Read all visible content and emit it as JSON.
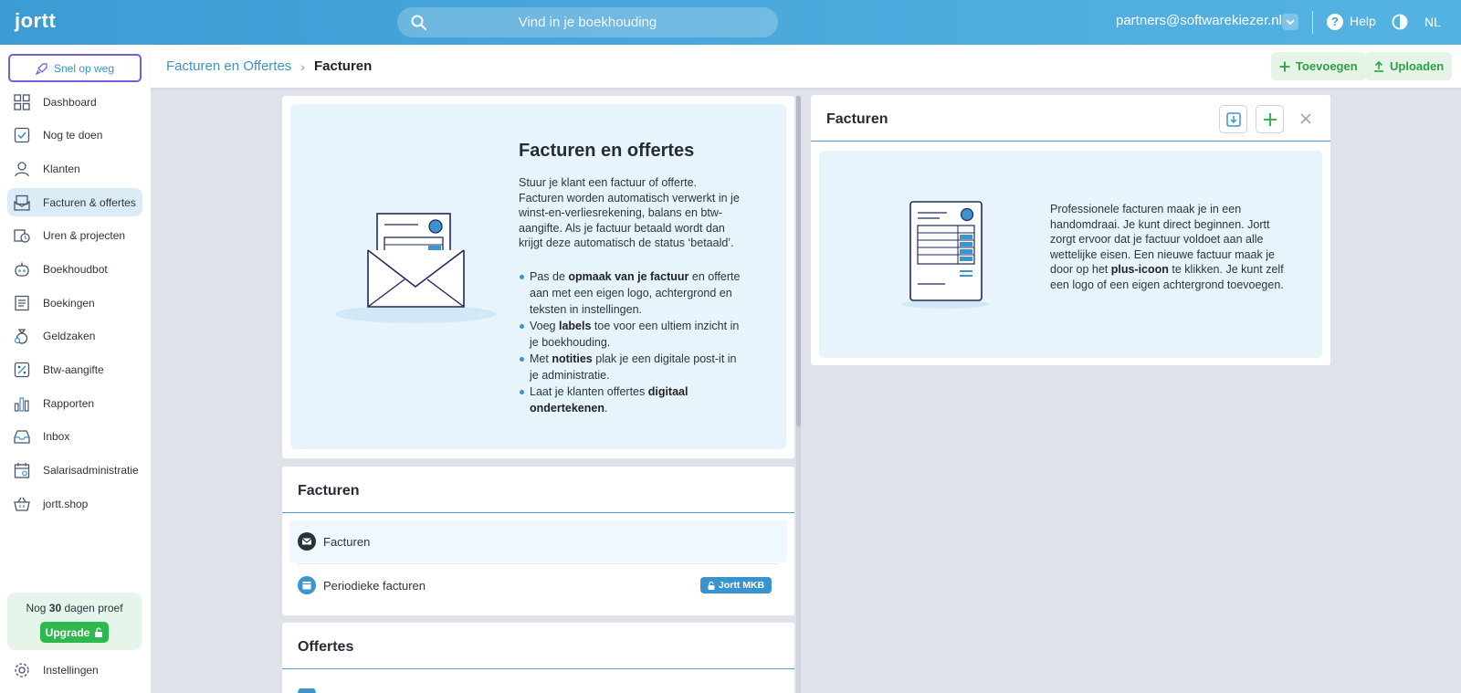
{
  "topbar": {
    "logo": "jortt",
    "search_placeholder": "Vind in je boekhouding",
    "account": "partners@softwarekiezer.nl",
    "help": "Help",
    "language": "NL"
  },
  "sidebar": {
    "quickstart": "Snel op weg",
    "items": [
      {
        "label": "Dashboard",
        "icon": "dashboard-icon"
      },
      {
        "label": "Nog te doen",
        "icon": "checkbox-icon"
      },
      {
        "label": "Klanten",
        "icon": "user-icon"
      },
      {
        "label": "Facturen & offertes",
        "icon": "invoice-icon",
        "active": true
      },
      {
        "label": "Uren & projecten",
        "icon": "clock-icon"
      },
      {
        "label": "Boekhoudbot",
        "icon": "bot-icon"
      },
      {
        "label": "Boekingen",
        "icon": "book-icon"
      },
      {
        "label": "Geldzaken",
        "icon": "money-bag-icon"
      },
      {
        "label": "Btw-aangifte",
        "icon": "percent-icon"
      },
      {
        "label": "Rapporten",
        "icon": "bar-chart-icon"
      },
      {
        "label": "Inbox",
        "icon": "inbox-icon"
      },
      {
        "label": "Salarisadministratie",
        "icon": "calendar-icon"
      },
      {
        "label": "jortt.shop",
        "icon": "basket-icon"
      }
    ],
    "trial": {
      "prefix": "Nog ",
      "days": "30",
      "suffix": " dagen proef",
      "upgrade": "Upgrade"
    },
    "settings": "Instellingen"
  },
  "subheader": {
    "breadcrumb_parent": "Facturen en Offertes",
    "breadcrumb_current": "Facturen",
    "add_label": "Toevoegen",
    "upload_label": "Uploaden"
  },
  "intro": {
    "title": "Facturen en offertes",
    "description": "Stuur je klant een factuur of offerte. Facturen worden automatisch verwerkt in je winst-en-verliesrekening, balans en btw-aangifte. Als je factuur betaald wordt dan krijgt deze automatisch de status ‘betaald’.",
    "bullets": [
      {
        "pre": "Pas de ",
        "bold": "opmaak van je factuur",
        "post": " en offerte aan met een eigen logo, achtergrond en teksten in instellingen."
      },
      {
        "pre": "Voeg ",
        "bold": "labels",
        "post": " toe voor een ultiem inzicht in je boekhouding."
      },
      {
        "pre": "Met ",
        "bold": "notities",
        "post": " plak je een digitale post-it in je administratie."
      },
      {
        "pre": "Laat je klanten offertes ",
        "bold": "digitaal ondertekenen",
        "post": "."
      }
    ]
  },
  "invoices_card": {
    "title": "Facturen",
    "rows": [
      {
        "label": "Facturen",
        "icon": "envelope-icon"
      },
      {
        "label": "Periodieke facturen",
        "icon": "calendar-icon",
        "badge": "Jortt MKB"
      }
    ]
  },
  "offers_card": {
    "title": "Offertes"
  },
  "panel": {
    "title": "Facturen",
    "text_pre": "Professionele facturen maak je in een handomdraai. Je kunt direct beginnen. Jortt zorgt ervoor dat je factuur voldoet aan alle wettelijke eisen. Een nieuwe factuur maak je door op het ",
    "text_bold": "plus-icoon",
    "text_post": " te klikken. Je kunt zelf een logo of een eigen achtergrond toevoegen."
  },
  "colors": {
    "accent": "#3b93d0",
    "green": "#2eb84e",
    "topbar": "#4aa8dc",
    "purple": "#7b5bd6"
  }
}
